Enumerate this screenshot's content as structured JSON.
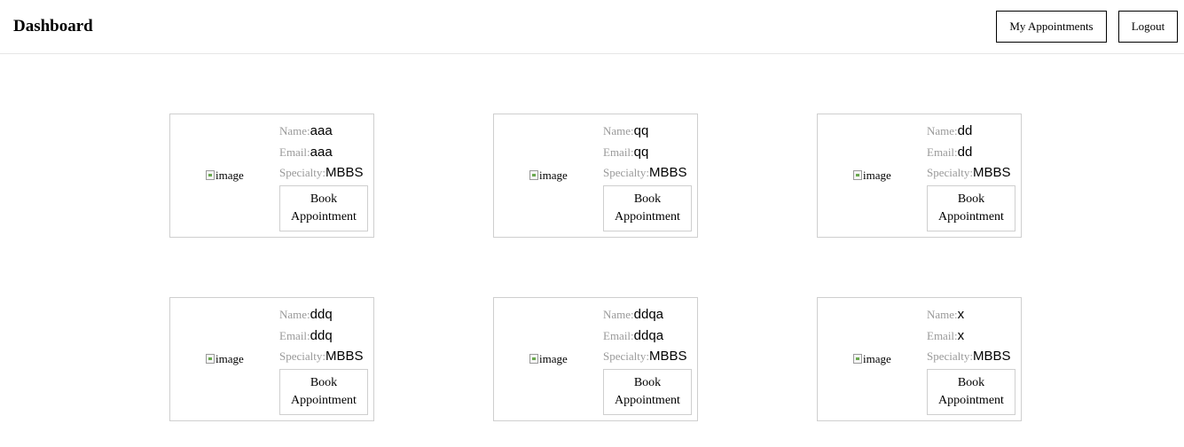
{
  "header": {
    "title": "Dashboard",
    "my_appointments_label": "My Appointments",
    "logout_label": "Logout"
  },
  "labels": {
    "name": "Name:",
    "email": "Email:",
    "specialty": "Specialty:",
    "image_alt": "image",
    "book_label": "Book Appointment"
  },
  "doctors": [
    {
      "name": "aaa",
      "email": "aaa",
      "specialty": "MBBS"
    },
    {
      "name": "qq",
      "email": "qq",
      "specialty": "MBBS"
    },
    {
      "name": "dd",
      "email": "dd",
      "specialty": "MBBS"
    },
    {
      "name": "ddq",
      "email": "ddq",
      "specialty": "MBBS"
    },
    {
      "name": "ddqa",
      "email": "ddqa",
      "specialty": "MBBS"
    },
    {
      "name": "x",
      "email": "x",
      "specialty": "MBBS"
    }
  ]
}
